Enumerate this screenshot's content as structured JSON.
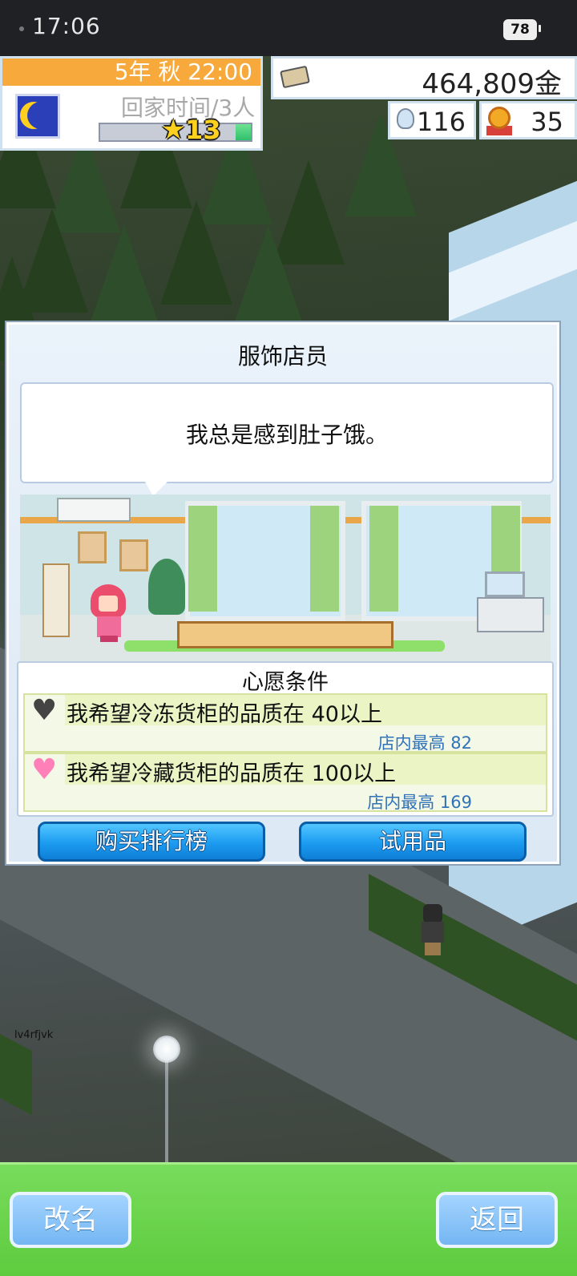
{
  "status_bar": {
    "time": "17:06",
    "battery": "78"
  },
  "hud": {
    "date": "5年 秋 22:00",
    "home_status": "回家时间/3人",
    "rank": "13",
    "progress": 0.1,
    "money": "464,809金",
    "research": "116",
    "medals": "35"
  },
  "scene": {
    "label": "lv4rfjvk"
  },
  "dialog": {
    "title": "服饰店员",
    "speech": "我总是感到肚子饿。",
    "wishes_title": "心愿条件",
    "wishes": [
      {
        "text": "我希望冷冻货柜的品质在 40以上",
        "best": "店内最高 82",
        "heart": "gray"
      },
      {
        "text": "我希望冷藏货柜的品质在 100以上",
        "best": "店内最高 169",
        "heart": "pink"
      }
    ],
    "buy_ranking_label": "购买排行榜",
    "trial_label": "试用品"
  },
  "bottom": {
    "rename_label": "改名",
    "back_label": "返回"
  },
  "icons": {
    "moon": "moon-icon",
    "money": "money-icon",
    "research": "bulb-icon",
    "medal": "medal-icon",
    "heart_gray": "heart-icon",
    "heart_pink": "heart-icon",
    "star": "star-icon"
  },
  "colors": {
    "accent_orange": "#f7a93c",
    "button_blue": "#1b9bf0",
    "bottom_green": "#6fd64e",
    "link_blue": "#2f72b8"
  }
}
